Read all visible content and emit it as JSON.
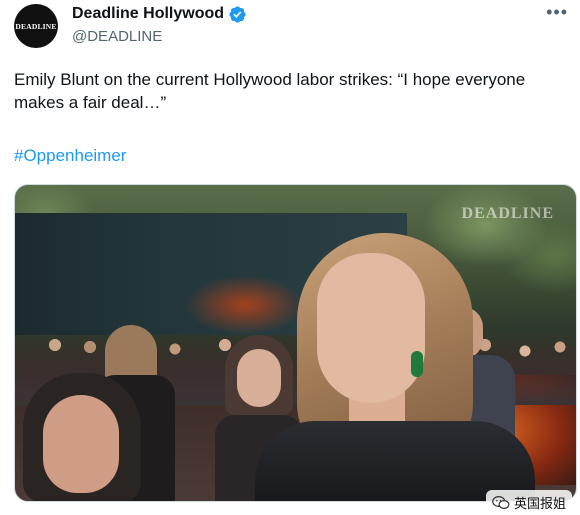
{
  "author": {
    "avatar_text": "DEADLINE",
    "display_name": "Deadline Hollywood",
    "handle": "@DEADLINE",
    "verified_icon": "verified-badge-icon"
  },
  "tweet": {
    "text": "Emily Blunt on the current Hollywood labor strikes: “I hope everyone makes a fair deal…”",
    "hashtag": "#Oppenheimer"
  },
  "media": {
    "watermark": "DEADLINE"
  },
  "source_badge": {
    "label": "英国报姐",
    "icon": "wechat-icon"
  },
  "colors": {
    "link": "#1d9bf0",
    "verified": "#1d9bf0",
    "secondary_text": "#536471"
  },
  "more_icon": "more-options-icon"
}
